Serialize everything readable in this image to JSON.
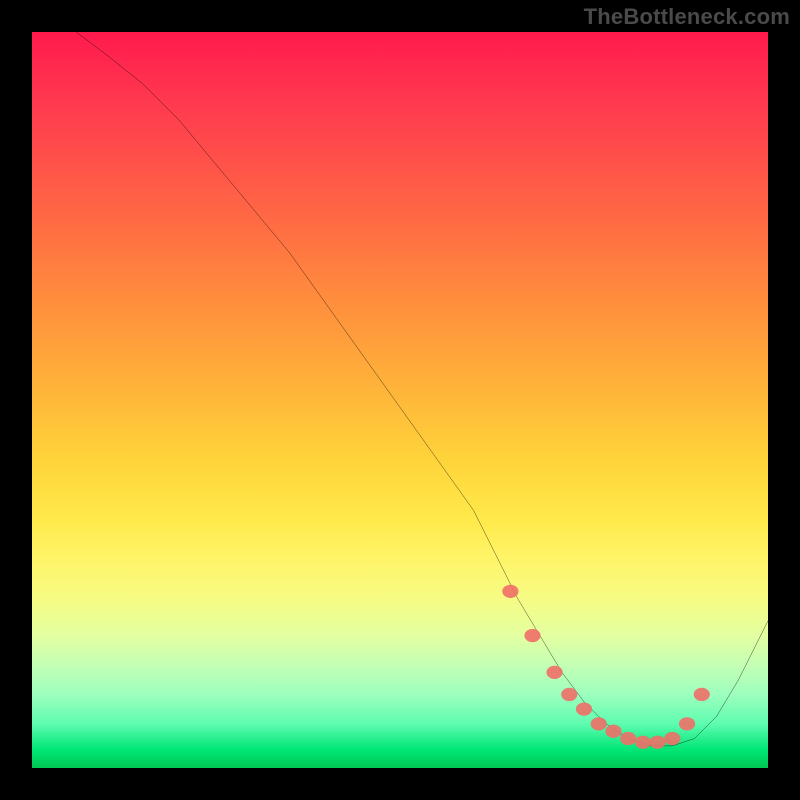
{
  "watermark": "TheBottleneck.com",
  "chart_data": {
    "type": "line",
    "title": "",
    "xlabel": "",
    "ylabel": "",
    "xlim": [
      0,
      100
    ],
    "ylim": [
      0,
      100
    ],
    "grid": false,
    "legend": false,
    "series": [
      {
        "name": "bottleneck-curve",
        "x": [
          6,
          10,
          15,
          20,
          25,
          30,
          35,
          40,
          45,
          50,
          55,
          60,
          63,
          66,
          69,
          72,
          75,
          78,
          81,
          84,
          87,
          90,
          93,
          96,
          100
        ],
        "y": [
          100,
          97,
          93,
          88,
          82,
          76,
          70,
          63,
          56,
          49,
          42,
          35,
          29,
          23,
          18,
          13,
          9,
          6,
          4,
          3,
          3,
          4,
          7,
          12,
          20
        ]
      }
    ],
    "markers": {
      "name": "highlight-points",
      "x": [
        65,
        68,
        71,
        73,
        75,
        77,
        79,
        81,
        83,
        85,
        87,
        89,
        91
      ],
      "y": [
        24,
        18,
        13,
        10,
        8,
        6,
        5,
        4,
        3.5,
        3.5,
        4,
        6,
        10
      ]
    },
    "gradient_stops": [
      {
        "pos": 0.0,
        "color": "#ff1a4d"
      },
      {
        "pos": 0.5,
        "color": "#ffcc33"
      },
      {
        "pos": 0.8,
        "color": "#f5ff80"
      },
      {
        "pos": 0.95,
        "color": "#33e38c"
      },
      {
        "pos": 1.0,
        "color": "#00c853"
      }
    ]
  }
}
